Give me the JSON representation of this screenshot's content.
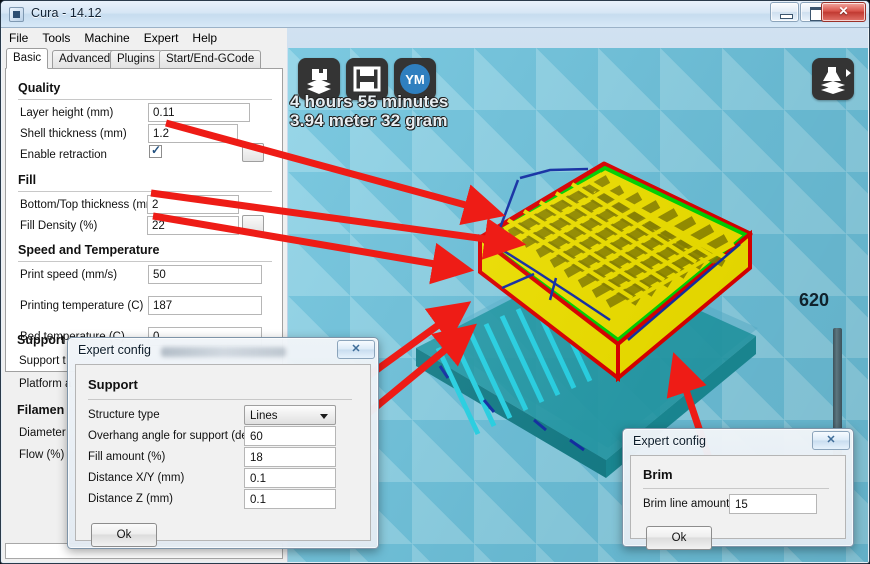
{
  "window": {
    "title": "Cura - 14.12",
    "icon": "app-icon",
    "buttons": {
      "minimize": "minimize",
      "maximize": "maximize",
      "close": "close"
    }
  },
  "menubar": {
    "items": [
      "File",
      "Tools",
      "Machine",
      "Expert",
      "Help"
    ]
  },
  "tabs": [
    {
      "label": "Basic",
      "active": true
    },
    {
      "label": "Advanced",
      "active": false
    },
    {
      "label": "Plugins",
      "active": false
    },
    {
      "label": "Start/End-GCode",
      "active": false
    }
  ],
  "settings": {
    "sections": [
      {
        "title": "Quality",
        "fields": [
          {
            "label": "Layer height (mm)",
            "value": "0.11",
            "type": "text"
          },
          {
            "label": "Shell thickness (mm)",
            "value": "1.2",
            "type": "text"
          },
          {
            "label": "Enable retraction",
            "value": "",
            "type": "checkbox",
            "checked": true
          }
        ]
      },
      {
        "title": "Fill",
        "fields": [
          {
            "label": "Bottom/Top thickness (mm)",
            "value": "2",
            "type": "text"
          },
          {
            "label": "Fill Density (%)",
            "value": "22",
            "type": "text"
          }
        ]
      },
      {
        "title": "Speed and Temperature",
        "fields": [
          {
            "label": "Print speed (mm/s)",
            "value": "50",
            "type": "text"
          },
          {
            "label": "Printing temperature (C)",
            "value": "187",
            "type": "text"
          },
          {
            "label": "Bed temperature (C)",
            "value": "0",
            "type": "text"
          }
        ]
      }
    ],
    "occluded_sections": [
      {
        "title": "Support",
        "fields": [
          "Support t",
          "Platform a"
        ]
      },
      {
        "title": "Filamen",
        "fields": [
          "Diameter",
          "Flow (%)"
        ]
      }
    ]
  },
  "viewport": {
    "toolbar": [
      {
        "name": "load-model-icon",
        "label": ""
      },
      {
        "name": "save-toolpath-icon",
        "label": ""
      },
      {
        "name": "youmagine-icon",
        "label": "YM"
      }
    ],
    "view_mode_icon": "layers-view-icon",
    "stats": {
      "time": "4 hours 55 minutes",
      "material": "3.94 meter 32 gram"
    },
    "scroll_value": "620"
  },
  "dialogs": [
    {
      "id": "support-dialog",
      "title": "Expert config",
      "section": "Support",
      "close_label": "✕",
      "fields": [
        {
          "label": "Structure type",
          "value": "Lines",
          "type": "select"
        },
        {
          "label": "Overhang angle for support (deg)",
          "value": "60",
          "type": "text"
        },
        {
          "label": "Fill amount (%)",
          "value": "18",
          "type": "text"
        },
        {
          "label": "Distance X/Y (mm)",
          "value": "0.1",
          "type": "text"
        },
        {
          "label": "Distance Z (mm)",
          "value": "0.1",
          "type": "text"
        }
      ],
      "ok_label": "Ok"
    },
    {
      "id": "brim-dialog",
      "title": "Expert config",
      "section": "Brim",
      "close_label": "✕",
      "fields": [
        {
          "label": "Brim line amount",
          "value": "15",
          "type": "text"
        }
      ],
      "ok_label": "Ok"
    }
  ],
  "annotations": {
    "arrow_color": "#ee1c16",
    "count": 6,
    "description": "Red arrows linking settings values to the sliced 3D preview"
  },
  "colors": {
    "viewport_bg": "#72c5de",
    "model_infill": "#f2e400",
    "model_outline_green": "#00d800",
    "model_outline_red": "#e00000",
    "support_cyan": "#2ad7ea",
    "support_teal": "#1f9aa6",
    "arrow_red": "#ee1c16",
    "toolbar_btn": "#343434",
    "accent_blue": "#2f7fbf"
  }
}
